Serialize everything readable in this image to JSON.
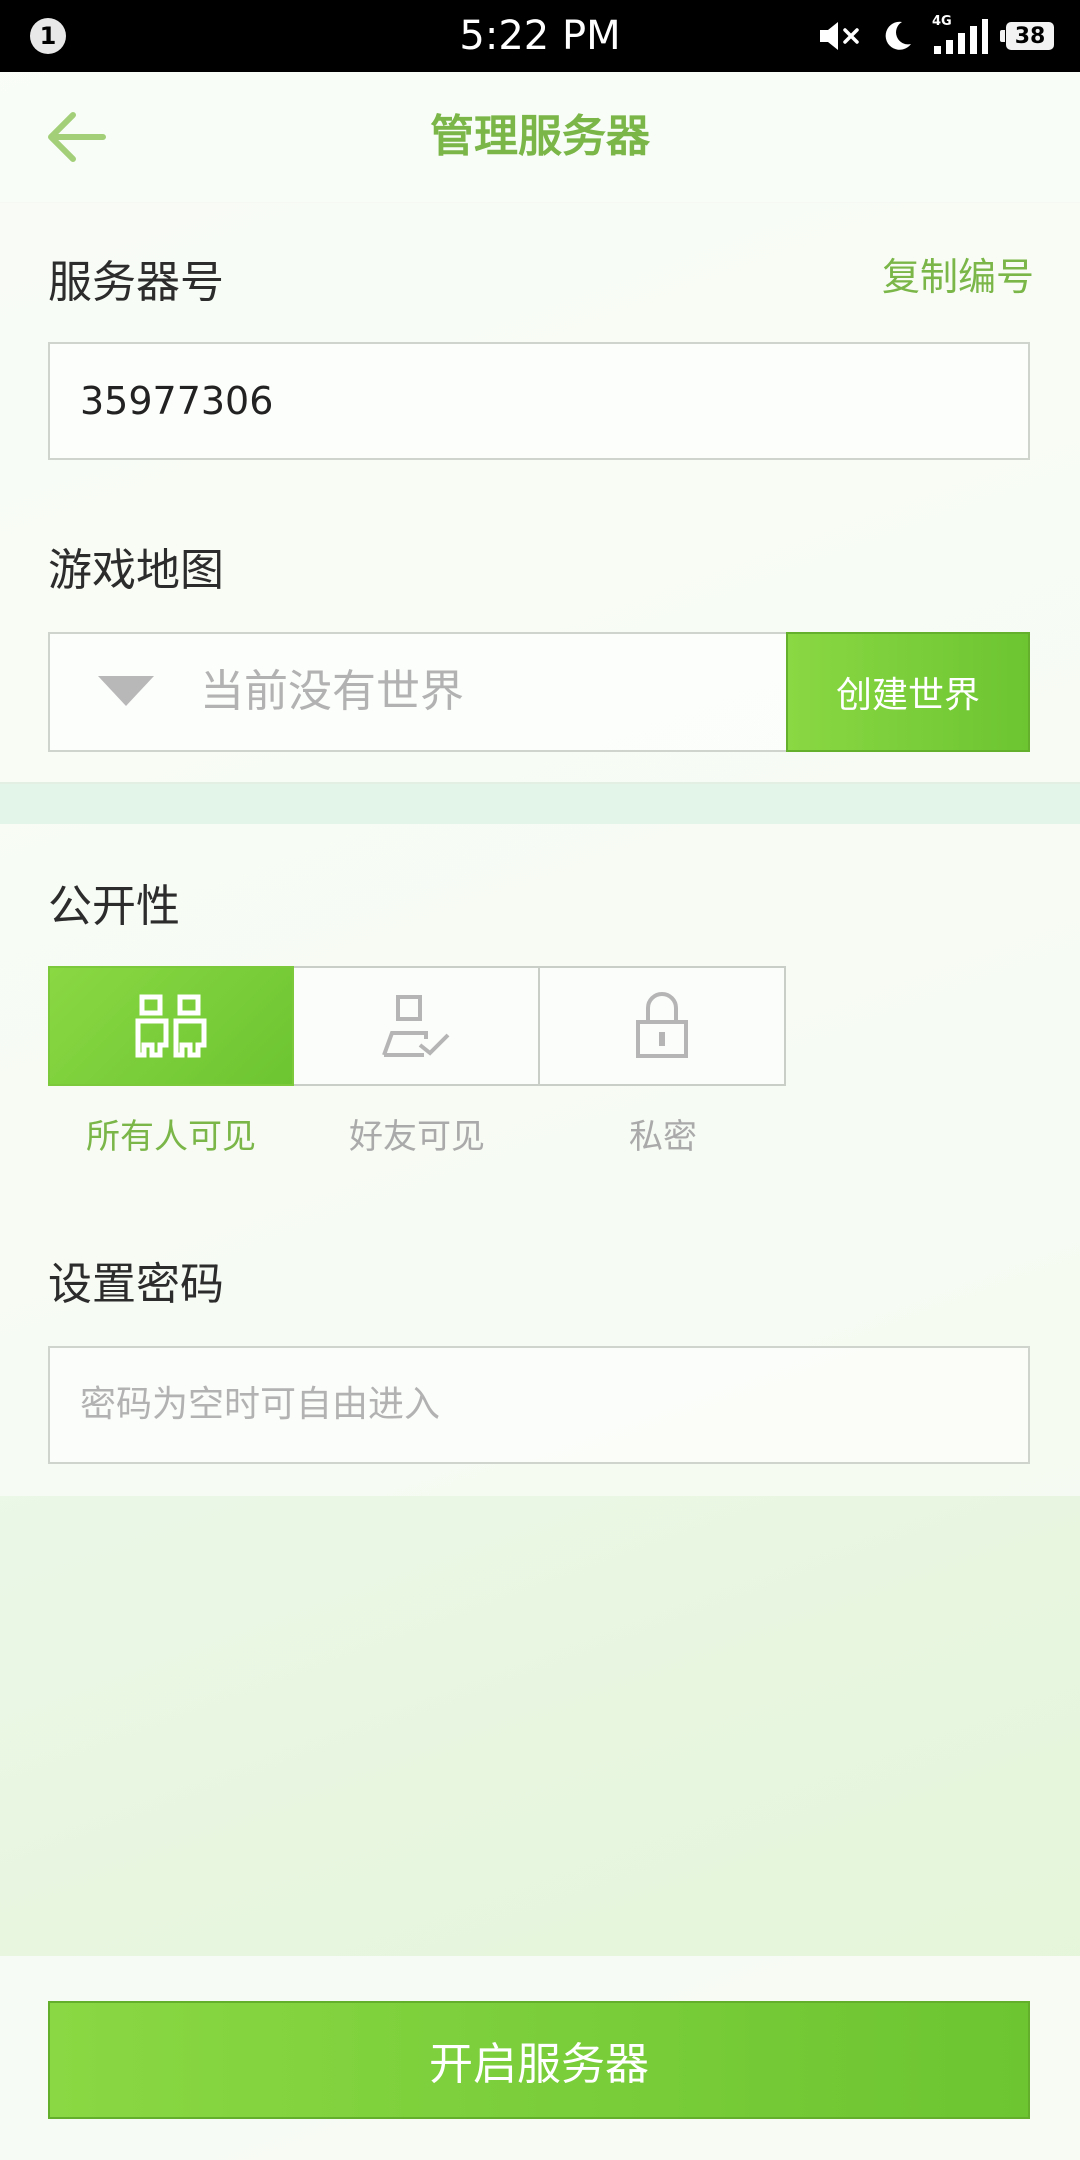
{
  "status_bar": {
    "notification_count": "1",
    "time": "5:22 PM",
    "network": "4G",
    "battery": "38"
  },
  "header": {
    "title": "管理服务器",
    "back_icon": "arrow-left-icon"
  },
  "server": {
    "label": "服务器号",
    "copy_label": "复制编号",
    "number": "35977306"
  },
  "map": {
    "label": "游戏地图",
    "selected": "当前没有世界",
    "create_label": "创建世界"
  },
  "visibility": {
    "label": "公开性",
    "options": [
      {
        "label": "所有人可见",
        "icon": "two-people-icon",
        "active": true
      },
      {
        "label": "好友可见",
        "icon": "person-check-icon",
        "active": false
      },
      {
        "label": "私密",
        "icon": "lock-icon",
        "active": false
      }
    ]
  },
  "password": {
    "label": "设置密码",
    "placeholder": "密码为空时可自由进入",
    "value": ""
  },
  "footer": {
    "start_label": "开启服务器"
  },
  "colors": {
    "accent": "#7ab648",
    "button_green": "#6cc531",
    "placeholder": "#b2b2b2"
  }
}
